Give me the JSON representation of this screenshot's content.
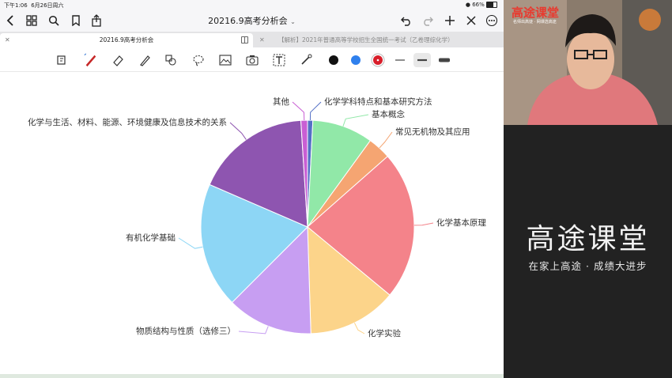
{
  "status_bar": {
    "time": "下午1:06",
    "date": "6月26日周六",
    "battery": "66%"
  },
  "document": {
    "title": "20216.9高考分析会"
  },
  "tabs": [
    {
      "label": "20216.9高考分析会"
    },
    {
      "label": "【解析】2021年普通高等学校招生全国统一考试（乙卷理综化学）"
    }
  ],
  "colors": {
    "pen_black": "#111111",
    "pen_blue": "#2f80ed",
    "pen_red": "#d81e2a"
  },
  "chart_data": {
    "type": "pie",
    "slices": [
      {
        "label": "化学学科特点和基本研究方法",
        "value": 0.8,
        "color": "#5470c6"
      },
      {
        "label": "基本概念",
        "value": 9.2,
        "color": "#91e8a8"
      },
      {
        "label": "常见无机物及其应用",
        "value": 3.5,
        "color": "#f5a572"
      },
      {
        "label": "化学基本原理",
        "value": 22.5,
        "color": "#f4838a"
      },
      {
        "label": "化学实验",
        "value": 13.5,
        "color": "#fcd48a"
      },
      {
        "label": "物质结构与性质（选修三）",
        "value": 13.0,
        "color": "#c79ef2"
      },
      {
        "label": "有机化学基础",
        "value": 19.0,
        "color": "#8dd6f5"
      },
      {
        "label": "化学与生活、材料、能源、环境健康及信息技术的关系",
        "value": 17.5,
        "color": "#8e55b0"
      },
      {
        "label": "其他",
        "value": 1.0,
        "color": "#c95fd4"
      }
    ]
  },
  "brand": {
    "title": "高途课堂",
    "slogan": "在家上高途 · 成绩大进步",
    "logo": "高途课堂",
    "logo_sub": "名师出高徒 · 网课选高途"
  }
}
